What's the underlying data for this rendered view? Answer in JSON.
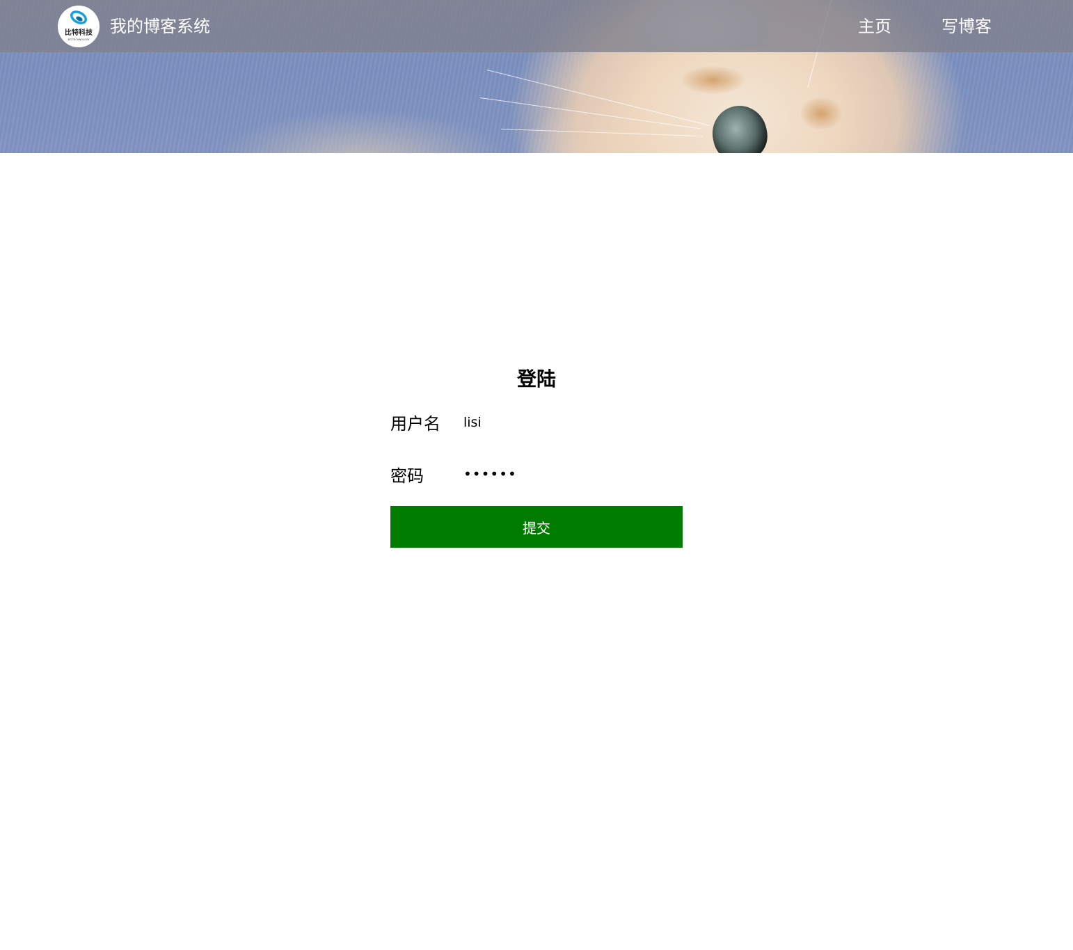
{
  "nav": {
    "logo_text_cn": "比特科技",
    "logo_text_en": "BIT-TECHNOLOGY",
    "title": "我的博客系统",
    "links": [
      {
        "label": "主页"
      },
      {
        "label": "写博客"
      }
    ]
  },
  "login": {
    "title": "登陆",
    "username_label": "用户名",
    "username_value": "lisi",
    "password_label": "密码",
    "password_value": "123456",
    "submit_label": "提交"
  },
  "colors": {
    "nav_overlay": "#80808c",
    "submit_bg": "#007d00",
    "submit_text": "#ffffff",
    "logo_ring": "#1aa0d8"
  }
}
